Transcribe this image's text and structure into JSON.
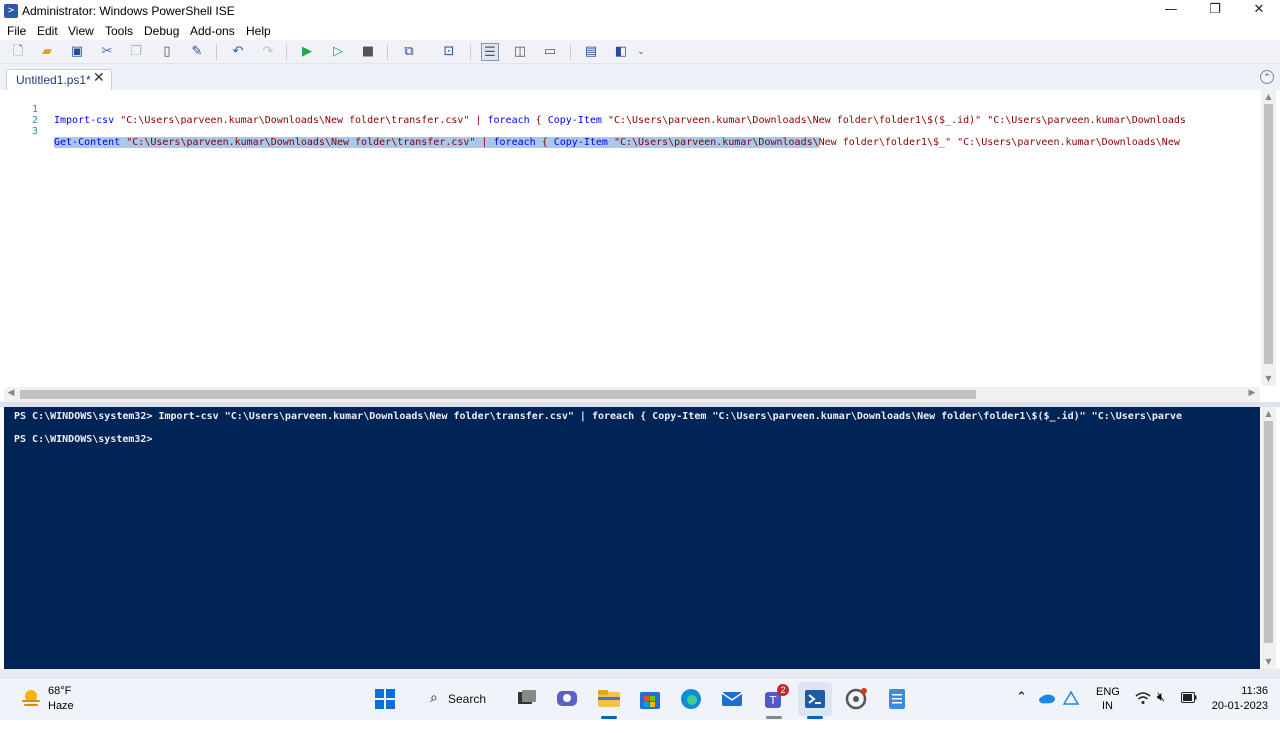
{
  "window": {
    "title": "Administrator: Windows PowerShell ISE",
    "app_icon": "powershell-ise-icon",
    "minimize": "—",
    "restore": "❐",
    "close": "✕"
  },
  "menu": [
    "File",
    "Edit",
    "View",
    "Tools",
    "Debug",
    "Add-ons",
    "Help"
  ],
  "toolbar_icons": [
    "new-icon",
    "open-icon",
    "save-icon",
    "cut-icon",
    "copy-icon",
    "paste-icon",
    "clear-icon",
    "undo-icon",
    "redo-icon",
    "run-icon",
    "run-selection-icon",
    "stop-icon",
    "remote-icon",
    "powershell-icon",
    "show-script-top-icon",
    "show-script-right-icon",
    "show-script-max-icon",
    "command-icon",
    "addon-icon"
  ],
  "tab": {
    "label": "Untitled1.ps1*",
    "close": "✕"
  },
  "editor": {
    "lines": [
      {
        "num": "1",
        "parts": [
          {
            "t": "Import-csv",
            "c": "cmd"
          },
          {
            "t": " \"C:\\Users\\parveen.kumar\\Downloads\\New folder\\transfer.csv\"",
            "c": "str"
          },
          {
            "t": " | ",
            "c": "str"
          },
          {
            "t": "foreach",
            "c": "cmd"
          },
          {
            "t": " { ",
            "c": "str"
          },
          {
            "t": "Copy-Item",
            "c": "cmd"
          },
          {
            "t": " \"C:\\Users\\parveen.kumar\\Downloads\\New folder\\folder1\\$($_.id)\" \"C:\\Users\\parveen.kumar\\Downloads",
            "c": "str"
          }
        ]
      },
      {
        "num": "2",
        "parts": []
      },
      {
        "num": "3",
        "parts": [
          {
            "t": "Get-Content",
            "c": "cmd sel"
          },
          {
            "t": " \"C:\\Users\\parveen.kumar\\Downloads\\New folder\\transfer.csv\" | ",
            "c": "str sel"
          },
          {
            "t": "foreach",
            "c": "cmd sel"
          },
          {
            "t": " { ",
            "c": "str sel"
          },
          {
            "t": "Copy-Item",
            "c": "cmd sel"
          },
          {
            "t": " \"C:\\Users\\parveen.kumar\\Downloads\\",
            "c": "str sel"
          },
          {
            "t": "New folder\\folder1\\$_\" \"C:\\Users\\parveen.kumar\\Downloads\\New",
            "c": "str"
          }
        ]
      }
    ]
  },
  "console": {
    "lines": [
      "PS C:\\WINDOWS\\system32> Import-csv \"C:\\Users\\parveen.kumar\\Downloads\\New folder\\transfer.csv\" | foreach { Copy-Item \"C:\\Users\\parveen.kumar\\Downloads\\New folder\\folder1\\$($_.id)\" \"C:\\Users\\parve",
      "PS C:\\WINDOWS\\system32>"
    ]
  },
  "taskbar": {
    "weather_temp": "68°F",
    "weather_desc": "Haze",
    "search_label": "Search",
    "search_icon": "search-icon",
    "teams_badge": "2",
    "apps": [
      "start-icon",
      "search-icon",
      "task-view-icon",
      "chat-icon",
      "file-explorer-icon",
      "store-icon",
      "edge-icon",
      "mail-icon",
      "teams-icon",
      "powershell-icon",
      "settings-icon",
      "notepad-icon"
    ],
    "tray": {
      "lang_top": "ENG",
      "lang_bottom": "IN",
      "time": "11:36",
      "date": "20-01-2023"
    }
  }
}
